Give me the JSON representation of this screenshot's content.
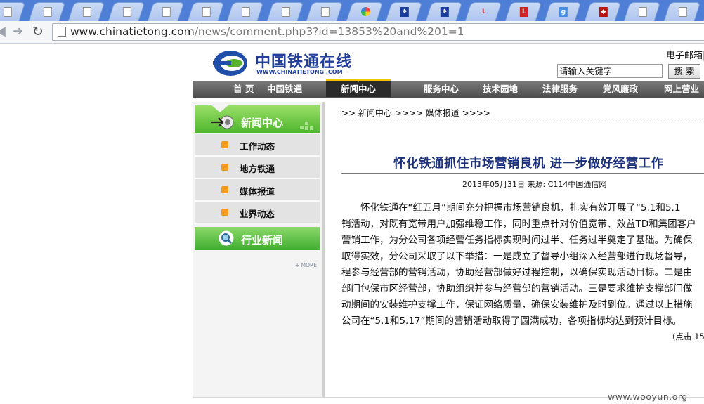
{
  "browser": {
    "tabs": [
      {
        "icon": "page-icon"
      },
      {
        "icon": "page-icon"
      },
      {
        "icon": "page-icon"
      },
      {
        "icon": "page-icon"
      },
      {
        "icon": "page-icon"
      },
      {
        "icon": "page-icon"
      },
      {
        "icon": "page-icon"
      },
      {
        "icon": "page-icon"
      },
      {
        "icon": "page-icon"
      },
      {
        "icon": "colorful-circle-icon"
      },
      {
        "icon": "paw-icon"
      },
      {
        "icon": "paw-icon"
      },
      {
        "icon": "l-logo-icon"
      },
      {
        "icon": "l-logo-icon"
      },
      {
        "icon": "google-icon"
      },
      {
        "icon": "shield-icon"
      },
      {
        "icon": "page-icon"
      },
      {
        "icon": "page-icon"
      },
      {
        "icon": "page-icon"
      }
    ],
    "url_host": "www.chinatietong.com",
    "url_path": "/news/comment.php3?id=13853%20and%201=1"
  },
  "site": {
    "logo_cn": "中国铁通在线",
    "logo_en": "WWW.CHINATIETONG .COM",
    "email_link": "电子邮箱|",
    "search_placeholder": "请输入关键字",
    "search_button": "搜 索",
    "nav": [
      "首 页",
      "中国铁通",
      "新闻中心",
      "服务中心",
      "技术园地",
      "法律服务",
      "党风廉政",
      "网上营业"
    ],
    "nav_active": "新闻中心",
    "sidebar": {
      "head_title": "新闻中心",
      "items": [
        "工作动态",
        "地方铁通",
        "媒体报道",
        "业界动态"
      ],
      "head2_title": "行业新闻",
      "more": "+ MORE"
    },
    "breadcrumb": ">> 新闻中心 >>>> 媒体报道 >>>>",
    "article": {
      "title": "怀化铁通抓住市场营销良机 进一步做好经营工作",
      "meta": "2013年05月31日 来源: C114中国通信网",
      "lines": [
        "　　怀化铁通在“红五月”期间充分把握市场营销良机，扎实有效开展了“5.1和5.1",
        "销活动，对既有宽带用户加强维稳工作，同时重点针对价值宽带、效益TD和集团客户",
        "营销工作，为分公司各项经营任务指标实现时间过半、任务过半奠定了基础。为确保",
        "取得实效，分公司采取了以下举措：一是成立了督导小组深入经营部进行现场督导，",
        "程参与经营部的营销活动，协助经营部做好过程控制，以确保实现活动目标。二是由",
        "部门包保市区经营部，协助组织并参与经营部的营销活动。三是要求维护支撑部门做",
        "动期间的安装维护支撑工作，保证网络质量，确保安装维护及时到位。通过以上措施",
        "公司在“5.1和5.17”期间的营销活动取得了圆满成功，各项指标均达到预计目标。"
      ],
      "clicks": "(点击 15"
    }
  },
  "watermark": "www.wooyun.org",
  "colors": {
    "tab_strip": "#4f7ed6",
    "nav_bg": "#5a5a5a",
    "sidebar_green": "#4fb62d",
    "title_blue": "#1b2f7a",
    "bullet_orange": "#f39a1e"
  }
}
